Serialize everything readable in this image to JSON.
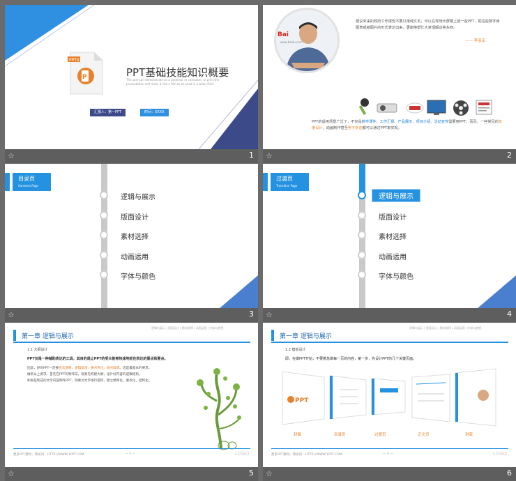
{
  "slides": [
    {
      "number": "1",
      "title": "PPT基础技能知识概要",
      "subtitle": "The user can demonstrate on a projector or computer, or print the presentation and make it into a film to be used in a wider field",
      "reporter": "汇报人：第一PPT",
      "time": "时间：XXXX"
    },
    {
      "number": "2",
      "quote": "建议未来的政府工作报告不要只用纯文本，可以在现场大屏幕上放一些PPT，把这些数字用图表或者图片的形式表达出来，更能够帮忙大家理解这些东西。",
      "quote_author": "—— 李彦宏",
      "body_a": "PPT的适用场景广泛了，不仅是",
      "body_b": "数学课件、工作汇报、产品展示、项目介绍、活动宣传",
      "body_c": "需要用PPT，而且，一些常见的",
      "body_d": "年度设计",
      "body_e": "，动画制作甚至",
      "body_f": "电子杂志",
      "body_g": "都可以通过PPT来实现。",
      "logo": "Bai 百度",
      "url": "www.baidu.com"
    },
    {
      "number": "3",
      "header": "目录页",
      "header_en": "Contents Page",
      "items": [
        "逻辑与展示",
        "版面设计",
        "素材选择",
        "动画运用",
        "字体与颜色"
      ]
    },
    {
      "number": "4",
      "header": "过渡页",
      "header_en": "Transition Page",
      "items": [
        "逻辑与展示",
        "版面设计",
        "素材选择",
        "动画运用",
        "字体与颜色"
      ]
    },
    {
      "number": "5",
      "chapter": "第一章  逻辑与展示",
      "section": "1.1 大纲设计",
      "lead": "PPT仅是一种辅助表达的工具，其目的是让PPT的受众能够快速地抓住表达的重点和要点。",
      "l1": "因此，好的PPT一定要",
      "l1h": "层次清晰、逻辑紧凑、重点突出、观点鲜明",
      "l1b": "。这是最基本的要求。",
      "l2": "做到以上要求，首先在PPT的制作前，就要先构建大纲，设计好内容的逻辑结构。",
      "l3": "如果是现成的文字内容制作PPT，则要对文字进行提炼，使之精简化，要点化，结构化。",
      "nav": "逻辑与展示 | 版面设计 | 素材选择 | 动画运用 | 字体与颜色",
      "footer": "更多PPT素材，请访问：HTTP://WWW.1PPT.COM",
      "page": "— 3 —",
      "logo": "LOGO"
    },
    {
      "number": "6",
      "chapter": "第一章  逻辑与展示",
      "section": "1.2 模板设计",
      "lead": "即，在做PPT开始，不要着急做每一页的内容，第一步，先设计PPT的几个关键页面。",
      "labels": [
        "封面",
        "目录页",
        "过渡页",
        "正文页",
        "封底"
      ],
      "nav": "逻辑与展示 | 版面设计 | 素材选择 | 动画运用 | 字体与颜色",
      "footer": "更多PPT素材，请访问：HTTP://WWW.1PPT.COM",
      "page": "— 4 —",
      "logo": "LOGO",
      "mini_ppt": "PPT"
    }
  ],
  "colors": {
    "accent": "#2492e0",
    "navy": "#3d4a8a",
    "orange": "#e8812a"
  }
}
